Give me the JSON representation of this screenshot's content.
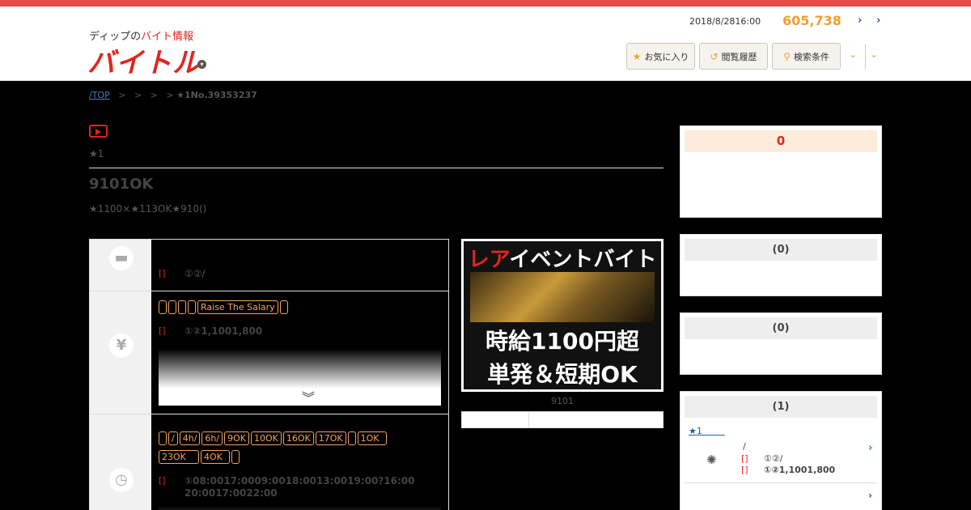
{
  "header": {
    "logo_sub_black": "ディップの",
    "logo_sub_red": "バイト情報",
    "logo_main": "バイトル",
    "date": "2018/8/2816:00",
    "count": "605,738",
    "nav_arrow_1": "›",
    "nav_arrow_2": "›",
    "buttons": [
      {
        "icon": "star-icon",
        "label": "お気に入り"
      },
      {
        "icon": "history-icon",
        "label": "閲覧履歴"
      },
      {
        "icon": "search-icon",
        "label": "検索条件"
      }
    ],
    "accent": "#f0a030",
    "brand": "#e0261d"
  },
  "breadcrumb": {
    "top": "/TOP",
    "separators": [
      ">",
      ">",
      ">",
      ">"
    ],
    "current": "★1No.39353237"
  },
  "job": {
    "rank": "★1",
    "title": "9101OK",
    "description": "★1100×★113OK★910()",
    "work_label": "[]",
    "work_value": "①②/",
    "salary_tags_left": [
      "",
      "",
      "",
      ""
    ],
    "salary_tag_main": "Raise The Salary",
    "salary_label": "[]",
    "salary_value": "①②1,1001,800",
    "expand_icon": "double-chevron-down-icon",
    "time_tags_row1": [
      "",
      "/",
      "4h/",
      "6h/",
      "9OK",
      "10OK",
      "16OK",
      "17OK",
      "",
      "1OK"
    ],
    "time_tags_row2": [
      "23OK",
      "4OK",
      ""
    ],
    "time_label": "[]",
    "time_value": "①08:0017:0009:0018:0013:0019:00?16:00 20:0017:0022:00"
  },
  "banner": {
    "line1_red": "レア",
    "line1_white": "イベントバイト",
    "line2": "時給1100円超",
    "line3": "単発＆短期OK",
    "caption": "9101"
  },
  "sidebar": {
    "counter": "0",
    "box2_title": "(0)",
    "box3_title": "(0)",
    "box4_title": "(1)",
    "fav": {
      "link": "★1",
      "line1": "/",
      "label1": "[]",
      "value1": "①②/",
      "label2": "[]",
      "value2": "①②1,1001,800",
      "more": "›"
    }
  }
}
